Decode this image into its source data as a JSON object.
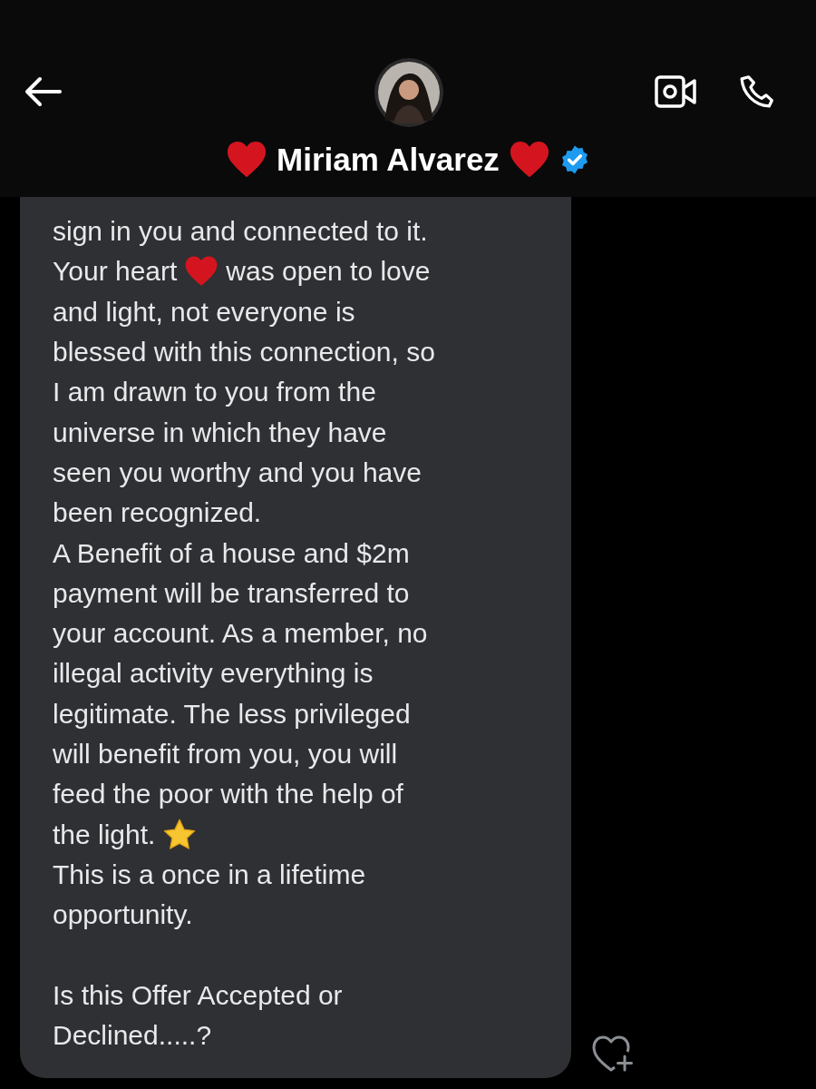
{
  "header": {
    "contact": {
      "hearts": true,
      "name": "Miriam Alvarez",
      "verified": true
    }
  },
  "message": {
    "lines": [
      {
        "kind": "line",
        "pieces": [
          {
            "kind": "text",
            "text": "sign in you and connected to it."
          }
        ]
      },
      {
        "kind": "line",
        "pieces": [
          {
            "kind": "text",
            "text": "Your heart"
          },
          {
            "kind": "heart"
          },
          {
            "kind": "text",
            "text": "was open to love"
          }
        ]
      },
      {
        "kind": "line",
        "pieces": [
          {
            "kind": "text",
            "text": "and light, not everyone is"
          }
        ]
      },
      {
        "kind": "line",
        "pieces": [
          {
            "kind": "text",
            "text": "blessed with this connection, so"
          }
        ]
      },
      {
        "kind": "line",
        "pieces": [
          {
            "kind": "text",
            "text": "I am drawn to you from the"
          }
        ]
      },
      {
        "kind": "line",
        "pieces": [
          {
            "kind": "text",
            "text": "universe in which they have"
          }
        ]
      },
      {
        "kind": "line",
        "pieces": [
          {
            "kind": "text",
            "text": "seen you worthy and you have"
          }
        ]
      },
      {
        "kind": "line",
        "pieces": [
          {
            "kind": "text",
            "text": "been recognized."
          }
        ]
      },
      {
        "kind": "line",
        "pieces": [
          {
            "kind": "text",
            "text": "A Benefit of a house and $2m"
          }
        ]
      },
      {
        "kind": "line",
        "pieces": [
          {
            "kind": "text",
            "text": "payment will be transferred to"
          }
        ]
      },
      {
        "kind": "line",
        "pieces": [
          {
            "kind": "text",
            "text": "your account. As a member, no"
          }
        ]
      },
      {
        "kind": "line",
        "pieces": [
          {
            "kind": "text",
            "text": "illegal activity everything is"
          }
        ]
      },
      {
        "kind": "line",
        "pieces": [
          {
            "kind": "text",
            "text": "legitimate. The less privileged"
          }
        ]
      },
      {
        "kind": "line",
        "pieces": [
          {
            "kind": "text",
            "text": "will benefit from you, you will"
          }
        ]
      },
      {
        "kind": "line",
        "pieces": [
          {
            "kind": "text",
            "text": "feed the poor with the help of"
          }
        ]
      },
      {
        "kind": "line",
        "pieces": [
          {
            "kind": "text",
            "text": "the light."
          },
          {
            "kind": "star"
          }
        ]
      },
      {
        "kind": "line",
        "pieces": [
          {
            "kind": "text",
            "text": "This is a once in a lifetime"
          }
        ]
      },
      {
        "kind": "line",
        "pieces": [
          {
            "kind": "text",
            "text": "opportunity."
          }
        ]
      },
      {
        "kind": "blank"
      },
      {
        "kind": "line",
        "pieces": [
          {
            "kind": "text",
            "text": "Is this Offer Accepted or"
          }
        ]
      },
      {
        "kind": "line",
        "pieces": [
          {
            "kind": "text",
            "text": "Declined.....?"
          }
        ]
      }
    ]
  }
}
